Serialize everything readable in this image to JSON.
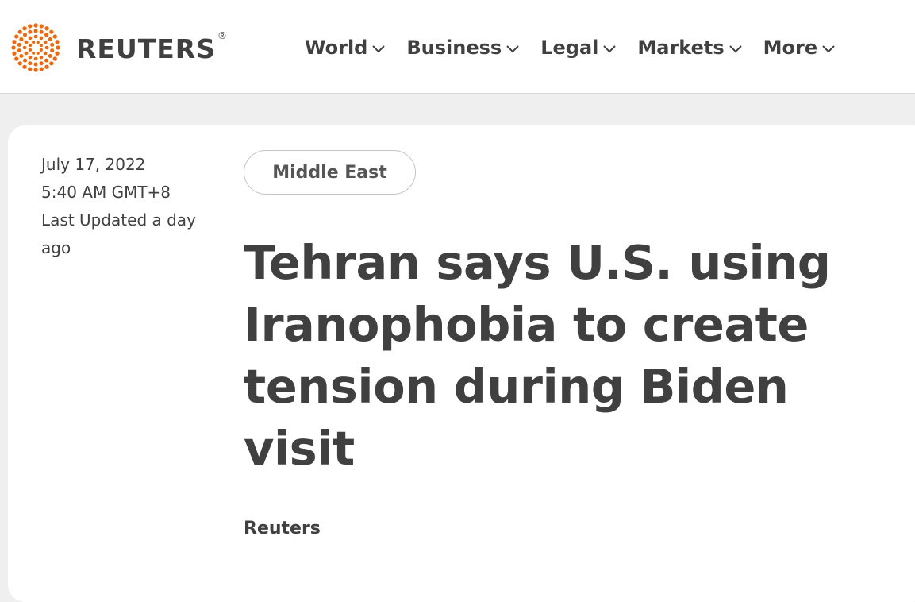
{
  "brand": {
    "name": "REUTERS",
    "registered": "®",
    "logo_icon": "reuters-dot-logo-icon",
    "accent_color": "#fa6400"
  },
  "nav": {
    "items": [
      {
        "label": "World",
        "icon": "chevron-down-icon"
      },
      {
        "label": "Business",
        "icon": "chevron-down-icon"
      },
      {
        "label": "Legal",
        "icon": "chevron-down-icon"
      },
      {
        "label": "Markets",
        "icon": "chevron-down-icon"
      },
      {
        "label": "More",
        "icon": "chevron-down-icon"
      }
    ]
  },
  "article": {
    "date": "July 17, 2022",
    "time": "5:40 AM GMT+8",
    "updated_line1": "Last Updated a day",
    "updated_line2": "ago",
    "section_tag": "Middle East",
    "headline_lines": [
      "Tehran says U.S. using",
      "Iranophobia to create",
      "tension during Biden",
      "visit"
    ],
    "byline": "Reuters"
  }
}
